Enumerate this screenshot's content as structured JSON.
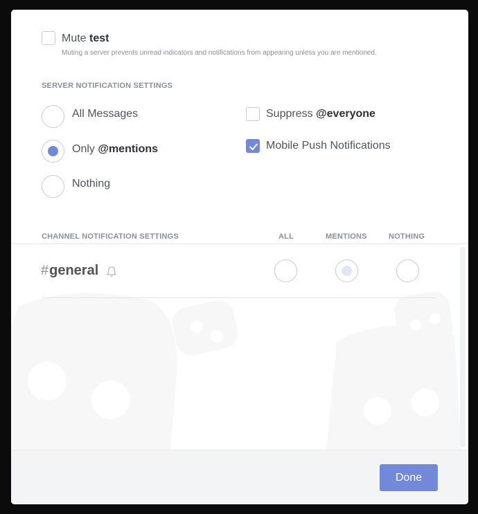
{
  "mute": {
    "label_prefix": "Mute ",
    "server_name": "test",
    "checked": false,
    "description": "Muting a server prevents unread indicators and notifications from appearing unless you are mentioned."
  },
  "server_settings": {
    "title": "SERVER NOTIFICATION SETTINGS",
    "options": [
      {
        "label": "All Messages",
        "selected": false
      },
      {
        "label_prefix": "Only ",
        "label_bold": "@mentions",
        "selected": true
      },
      {
        "label": "Nothing",
        "selected": false
      }
    ],
    "suppress": {
      "label_prefix": "Suppress ",
      "label_bold": "@everyone",
      "checked": false
    },
    "mobile_push": {
      "label": "Mobile Push Notifications",
      "checked": true
    }
  },
  "channel_settings": {
    "title": "CHANNEL NOTIFICATION SETTINGS",
    "columns": [
      "ALL",
      "MENTIONS",
      "NOTHING"
    ],
    "channels": [
      {
        "hash": "#",
        "name": "general",
        "icon": "bell-icon",
        "selected": "MENTIONS"
      }
    ]
  },
  "footer": {
    "done_label": "Done"
  },
  "colors": {
    "accent": "#7289da",
    "text": "#4f545c",
    "muted": "#87909c"
  }
}
